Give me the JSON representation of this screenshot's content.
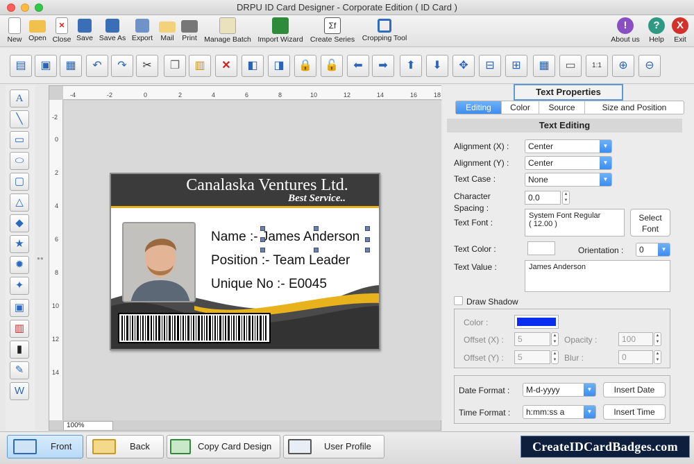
{
  "window": {
    "title": "DRPU ID Card Designer - Corporate Edition ( ID Card )"
  },
  "main_toolbar": {
    "new": "New",
    "open": "Open",
    "close": "Close",
    "save": "Save",
    "save_as": "Save As",
    "export": "Export",
    "mail": "Mail",
    "print": "Print",
    "manage_batch": "Manage Batch",
    "import_wizard": "Import Wizard",
    "create_series": "Create Series",
    "cropping_tool": "Cropping Tool",
    "about": "About us",
    "help": "Help",
    "exit": "Exit"
  },
  "canvas": {
    "zoom": "100%",
    "ruler_h": [
      "-4",
      "-2",
      "0",
      "2",
      "4",
      "6",
      "8",
      "10",
      "12",
      "14",
      "16",
      "18"
    ],
    "ruler_v": [
      "-2",
      "0",
      "2",
      "4",
      "6",
      "8",
      "10",
      "12",
      "14"
    ]
  },
  "card": {
    "company": "Canalaska Ventures Ltd.",
    "tagline": "Best Service..",
    "name_line": "Name :- James Anderson",
    "position_line": "Position :- Team Leader",
    "unique_line": "Unique No :-  E0045"
  },
  "panel": {
    "title": "Text Properties",
    "tabs": [
      "Editing",
      "Color",
      "Source",
      "Size and Position"
    ],
    "section": "Text Editing",
    "alignment_x_label": "Alignment (X) :",
    "alignment_x_value": "Center",
    "alignment_y_label": "Alignment (Y) :",
    "alignment_y_value": "Center",
    "text_case_label": "Text Case :",
    "text_case_value": "None",
    "char_spacing_label_1": "Character",
    "char_spacing_label_2": "Spacing :",
    "char_spacing_value": "0.0",
    "text_font_label": "Text Font :",
    "text_font_value_1": "System Font Regular",
    "text_font_value_2": "( 12.00 )",
    "select_font_1": "Select",
    "select_font_2": "Font",
    "text_color_label": "Text Color :",
    "orientation_label": "Orientation :",
    "orientation_value": "0",
    "text_value_label": "Text Value :",
    "text_value": "James Anderson",
    "draw_shadow": "Draw Shadow",
    "shadow_color_label": "Color :",
    "shadow_color": "#0a2ef0",
    "offset_x_label": "Offset (X) :",
    "offset_x_value": "5",
    "offset_y_label": "Offset (Y) :",
    "offset_y_value": "5",
    "opacity_label": "Opacity :",
    "opacity_value": "100",
    "blur_label": "Blur :",
    "blur_value": "0",
    "date_format_label": "Date Format :",
    "date_format_value": "M-d-yyyy",
    "insert_date": "Insert Date",
    "time_format_label": "Time Format :",
    "time_format_value": "h:mm:ss a",
    "insert_time": "Insert Time"
  },
  "bottom": {
    "front": "Front",
    "back": "Back",
    "copy_card_design": "Copy Card Design",
    "user_profile": "User Profile",
    "brand": "CreateIDCardBadges.com"
  },
  "colors": {
    "accent": "#3d8ef1",
    "card_header": "#3b3b3b",
    "card_gold": "#e8b21c"
  }
}
